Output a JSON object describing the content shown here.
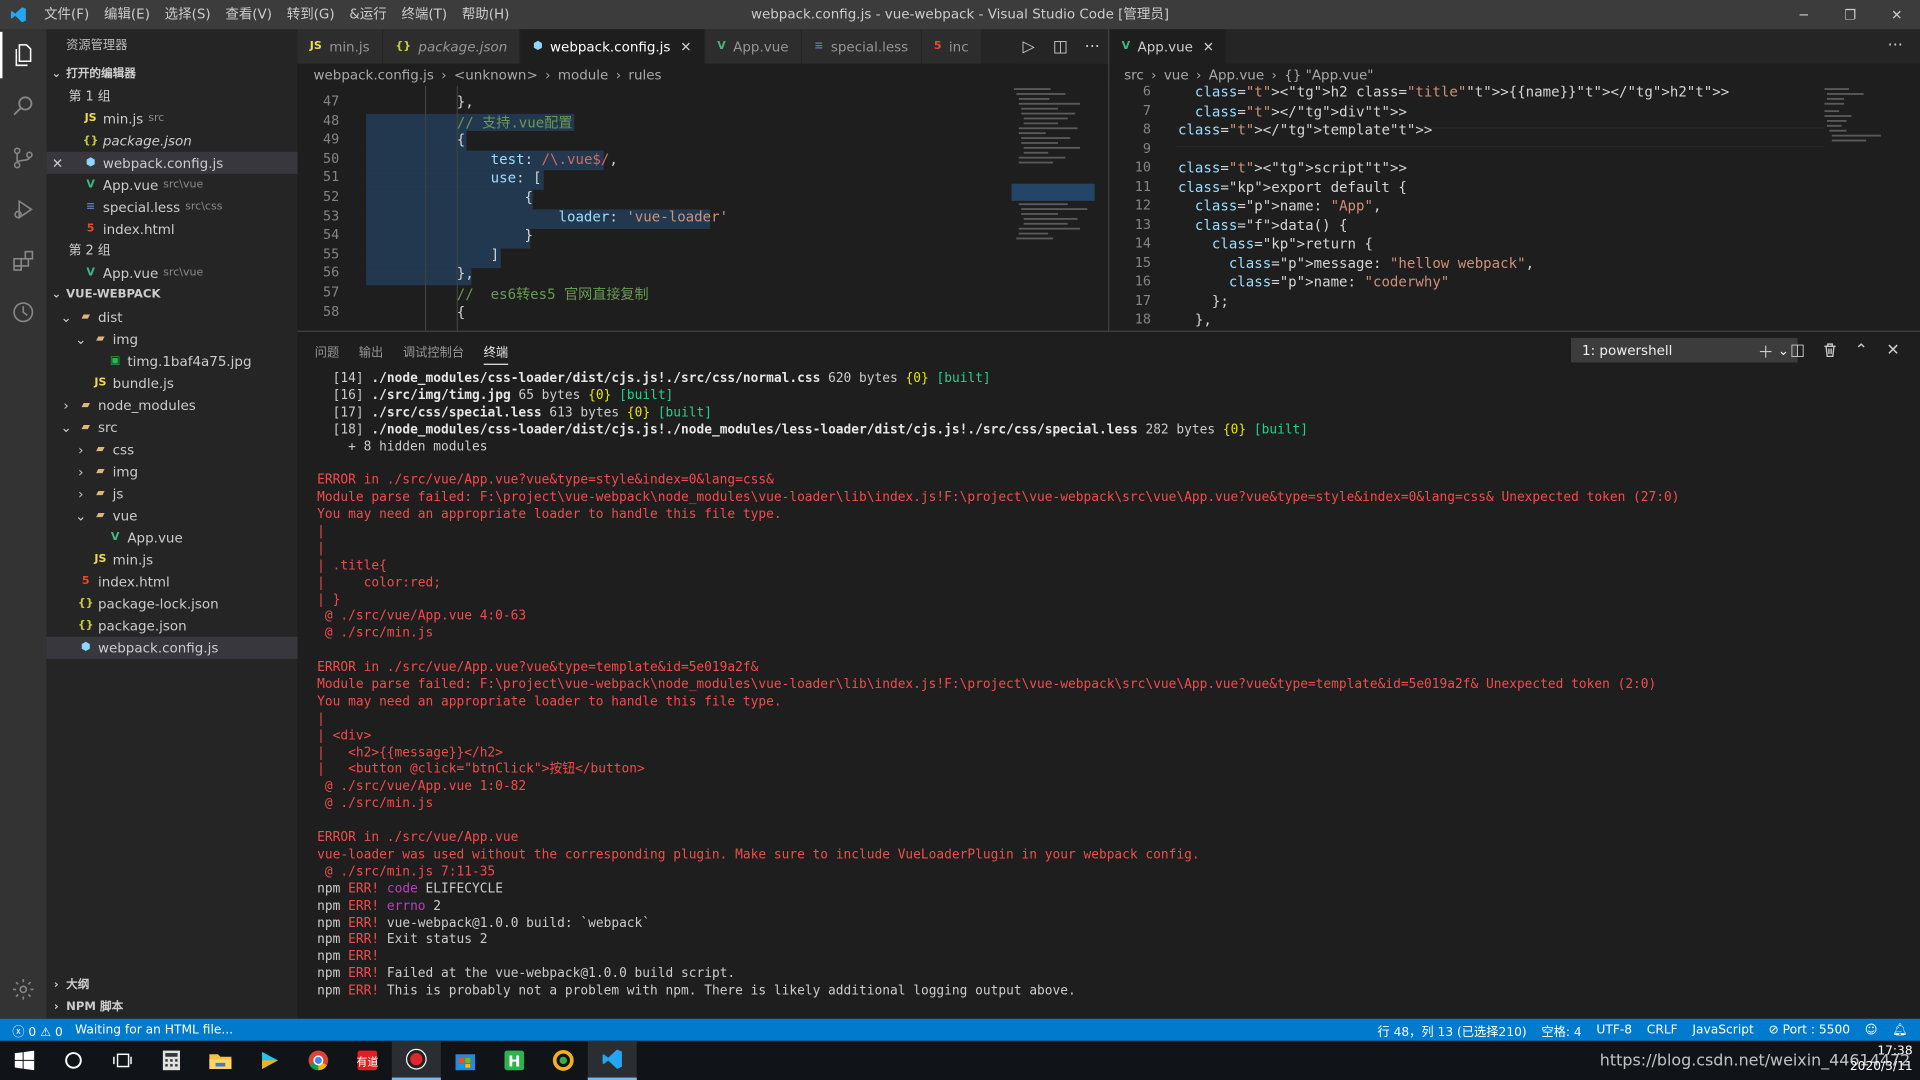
{
  "titlebar": {
    "menus": [
      "文件(F)",
      "编辑(E)",
      "选择(S)",
      "查看(V)",
      "转到(G)",
      "&运行",
      "终端(T)",
      "帮助(H)"
    ],
    "title": "webpack.config.js - vue-webpack - Visual Studio Code [管理员]"
  },
  "sidebar": {
    "title": "资源管理器",
    "open_editors_label": "打开的编辑器",
    "group1": "第 1 组",
    "group2": "第 2 组",
    "open_files_g1": [
      {
        "badge": "JS",
        "name": "min.js",
        "sub": "src"
      },
      {
        "badge": "{}",
        "name": "package.json",
        "sub": ""
      },
      {
        "badge": "⬢",
        "name": "webpack.config.js",
        "sub": ""
      },
      {
        "badge": "V",
        "name": "App.vue",
        "sub": "src\\vue"
      },
      {
        "badge": "≡",
        "name": "special.less",
        "sub": "src\\css"
      },
      {
        "badge": "5",
        "name": "index.html",
        "sub": ""
      }
    ],
    "open_files_g2": [
      {
        "badge": "V",
        "name": "App.vue",
        "sub": "src\\vue"
      }
    ],
    "project_label": "VUE-WEBPACK",
    "tree": [
      {
        "d": 0,
        "chev": "v",
        "kind": "folder",
        "name": "dist"
      },
      {
        "d": 1,
        "chev": "v",
        "kind": "folder",
        "name": "img"
      },
      {
        "d": 2,
        "chev": "",
        "kind": "img",
        "name": "timg.1baf4a75.jpg"
      },
      {
        "d": 1,
        "chev": "",
        "kind": "js",
        "name": "bundle.js"
      },
      {
        "d": 0,
        "chev": ">",
        "kind": "folder",
        "name": "node_modules"
      },
      {
        "d": 0,
        "chev": "v",
        "kind": "folder",
        "name": "src"
      },
      {
        "d": 1,
        "chev": ">",
        "kind": "folder",
        "name": "css"
      },
      {
        "d": 1,
        "chev": ">",
        "kind": "folder",
        "name": "img"
      },
      {
        "d": 1,
        "chev": ">",
        "kind": "folder",
        "name": "js"
      },
      {
        "d": 1,
        "chev": "v",
        "kind": "folder",
        "name": "vue"
      },
      {
        "d": 2,
        "chev": "",
        "kind": "vue",
        "name": "App.vue"
      },
      {
        "d": 1,
        "chev": "",
        "kind": "js",
        "name": "min.js"
      },
      {
        "d": 0,
        "chev": "",
        "kind": "html",
        "name": "index.html"
      },
      {
        "d": 0,
        "chev": "",
        "kind": "json",
        "name": "package-lock.json"
      },
      {
        "d": 0,
        "chev": "",
        "kind": "json",
        "name": "package.json"
      },
      {
        "d": 0,
        "chev": "",
        "kind": "wp",
        "name": "webpack.config.js"
      }
    ],
    "outline_label": "大纲",
    "npm_label": "NPM 脚本"
  },
  "tabs_left": [
    {
      "badge": "JS",
      "label": "min.js"
    },
    {
      "badge": "{}",
      "label": "package.json"
    },
    {
      "badge": "⬢",
      "label": "webpack.config.js"
    },
    {
      "badge": "V",
      "label": "App.vue"
    },
    {
      "badge": "≡",
      "label": "special.less"
    },
    {
      "badge": "5",
      "label": "inc"
    }
  ],
  "tab_right": {
    "badge": "V",
    "label": "App.vue"
  },
  "crumbs_left": [
    "webpack.config.js",
    "<unknown>",
    "module",
    "rules"
  ],
  "crumbs_right": [
    "src",
    "vue",
    "App.vue",
    "{} \"App.vue\""
  ],
  "colors": {
    "accent": "#007acc",
    "error": "#f14c4c",
    "success": "#23d18b"
  },
  "editor_left": {
    "lines": [
      "47",
      "48",
      "49",
      "50",
      "51",
      "52",
      "53",
      "54",
      "55",
      "56",
      "57",
      "58"
    ],
    "code": [
      "},",
      "// 支持.vue配置",
      "{",
      "    test: /\\.vue$/,",
      "    use: [",
      "        {",
      "            loader: 'vue-loader'",
      "        }",
      "    ]",
      "},",
      "//  es6转es5 官网直接复制",
      "{"
    ]
  },
  "editor_right": {
    "lines": [
      "6",
      "7",
      "8",
      "9",
      "10",
      "11",
      "12",
      "13",
      "14",
      "15",
      "16",
      "17",
      "18"
    ],
    "code": [
      "  <h2 class=\"title\">{{name}}</h2>",
      "  </div>",
      "</template>",
      "",
      "<script>",
      "export default {",
      "  name: \"App\",",
      "  data() {",
      "    return {",
      "      message: \"hellow webpack\",",
      "      name: \"coderwhy\"",
      "    };",
      "  },"
    ]
  },
  "panel": {
    "tabs": [
      "问题",
      "输出",
      "调试控制台",
      "终端"
    ],
    "terminal_select": "1: powershell"
  },
  "terminal": {
    "built_lines": [
      {
        "num": "[14]",
        "path": "./node_modules/css-loader/dist/cjs.js!./src/css/normal.css",
        "size": "620 bytes",
        "chunk": "{0}",
        "flag": "[built]"
      },
      {
        "num": "[16]",
        "path": "./src/img/timg.jpg",
        "size": "65 bytes",
        "chunk": "{0}",
        "flag": "[built]"
      },
      {
        "num": "[17]",
        "path": "./src/css/special.less",
        "size": "613 bytes",
        "chunk": "{0}",
        "flag": "[built]"
      },
      {
        "num": "[18]",
        "path": "./node_modules/css-loader/dist/cjs.js!./node_modules/less-loader/dist/cjs.js!./src/css/special.less",
        "size": "282 bytes",
        "chunk": "{0}",
        "flag": "[built]"
      }
    ],
    "hidden": "    + 8 hidden modules",
    "error_lines": [
      "",
      "ERROR in ./src/vue/App.vue?vue&type=style&index=0&lang=css&",
      "Module parse failed: F:\\project\\vue-webpack\\node_modules\\vue-loader\\lib\\index.js!F:\\project\\vue-webpack\\src\\vue\\App.vue?vue&type=style&index=0&lang=css& Unexpected token (27:0)",
      "You may need an appropriate loader to handle this file type.",
      "|",
      "|",
      "| .title{",
      "|     color:red;",
      "| }",
      " @ ./src/vue/App.vue 4:0-63",
      " @ ./src/min.js",
      "",
      "ERROR in ./src/vue/App.vue?vue&type=template&id=5e019a2f&",
      "Module parse failed: F:\\project\\vue-webpack\\node_modules\\vue-loader\\lib\\index.js!F:\\project\\vue-webpack\\src\\vue\\App.vue?vue&type=template&id=5e019a2f& Unexpected token (2:0)",
      "You may need an appropriate loader to handle this file type.",
      "|",
      "| <div>",
      "|   <h2>{{message}}</h2>",
      "|   <button @click=\"btnClick\">按钮</button>",
      " @ ./src/vue/App.vue 1:0-82",
      " @ ./src/min.js",
      "",
      "ERROR in ./src/vue/App.vue",
      "vue-loader was used without the corresponding plugin. Make sure to include VueLoaderPlugin in your webpack config.",
      " @ ./src/min.js 7:11-35"
    ],
    "npm_lines": [
      {
        "tag": "code",
        "text": " ELIFECYCLE"
      },
      {
        "tag": "errno",
        "text": " 2"
      },
      {
        "tag": "",
        "text": "vue-webpack@1.0.0 build: `webpack`"
      },
      {
        "tag": "",
        "text": "Exit status 2"
      },
      {
        "tag": "",
        "text": ""
      },
      {
        "tag": "",
        "text": "Failed at the vue-webpack@1.0.0 build script."
      },
      {
        "tag": "",
        "text": "This is probably not a problem with npm. There is likely additional logging output above."
      }
    ],
    "npm_prefix": "npm ",
    "npm_err": "ERR!"
  },
  "status": {
    "problems": "0",
    "warnings": "0",
    "message": "Waiting for an HTML file...",
    "position": "行 48，列 13 (已选择210)",
    "spaces": "空格: 4",
    "encoding": "UTF-8",
    "eol": "CRLF",
    "language": "JavaScript",
    "port": "Port : 5500"
  },
  "taskbar": {
    "time": "17:38",
    "date": "2020/3/11",
    "watermark": "https://blog.csdn.net/weixin_44614472"
  }
}
